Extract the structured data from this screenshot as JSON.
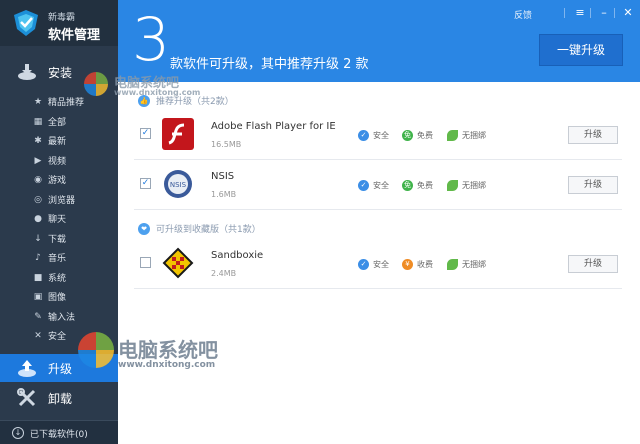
{
  "app": {
    "logo_sub": "新毒霸",
    "logo_title": "软件管理"
  },
  "sidebar": {
    "install_label": "安装",
    "categories": [
      {
        "label": "精品推荐",
        "icon": "star-icon"
      },
      {
        "label": "全部",
        "icon": "grid-icon"
      },
      {
        "label": "最新",
        "icon": "new-icon"
      },
      {
        "label": "视频",
        "icon": "video-icon"
      },
      {
        "label": "游戏",
        "icon": "game-icon"
      },
      {
        "label": "浏览器",
        "icon": "browser-icon"
      },
      {
        "label": "聊天",
        "icon": "chat-icon"
      },
      {
        "label": "下载",
        "icon": "download-icon"
      },
      {
        "label": "音乐",
        "icon": "music-icon"
      },
      {
        "label": "系统",
        "icon": "system-icon"
      },
      {
        "label": "图像",
        "icon": "image-icon"
      },
      {
        "label": "输入法",
        "icon": "pen-icon"
      },
      {
        "label": "安全",
        "icon": "tool-icon"
      }
    ],
    "upgrade_label": "升级",
    "uninstall_label": "卸载",
    "downloaded_label": "已下载软件(0)"
  },
  "header": {
    "count": "3",
    "headline": "款软件可升级，其中推荐升级 2 款",
    "feedback": "反馈",
    "one_click_upgrade": "一键升级"
  },
  "sections": {
    "recommended_title": "推荐升级（共2款）",
    "favorites_title": "可升级到收藏版（共1款）"
  },
  "software": [
    {
      "name": "Adobe Flash Player for IE",
      "size": "16.5MB",
      "checked": true,
      "tags": [
        "安全",
        "免费",
        "无捆绑"
      ],
      "button": "升级"
    },
    {
      "name": "NSIS",
      "size": "1.6MB",
      "checked": true,
      "tags": [
        "安全",
        "免费",
        "无捆绑"
      ],
      "button": "升级"
    },
    {
      "name": "Sandboxie",
      "size": "2.4MB",
      "checked": false,
      "tags": [
        "安全",
        "收费",
        "无捆绑"
      ],
      "button": "升级"
    }
  ],
  "watermark": {
    "text": "电脑系统吧",
    "url": "www.dnxitong.com"
  },
  "colors": {
    "header_blue": "#2a86e4",
    "sidebar": "#2b3a4c",
    "active_nav": "#1d79dd"
  }
}
